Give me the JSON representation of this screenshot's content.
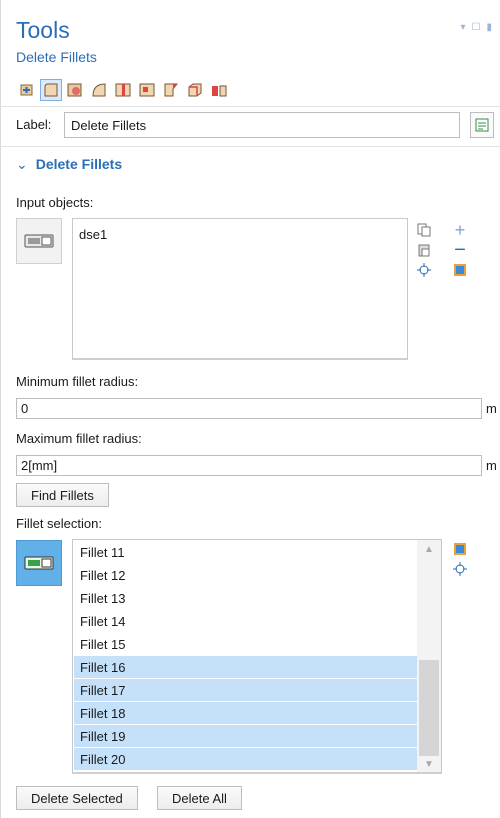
{
  "header": {
    "title": "Tools",
    "subtitle": "Delete Fillets"
  },
  "toolbar": {
    "icons": [
      "build-icon",
      "delete-fillets-icon",
      "cap-faces-icon",
      "delete-faces-icon",
      "split-face-icon",
      "merge-edges-icon",
      "collapse-edges-icon",
      "ignore-vertices-icon",
      "detach-faces-icon"
    ]
  },
  "label_row": {
    "label": "Label:",
    "value": "Delete Fillets"
  },
  "section": {
    "title": "Delete Fillets"
  },
  "input_objects": {
    "label": "Input objects:",
    "items": [
      "dse1"
    ]
  },
  "min_radius": {
    "label": "Minimum fillet radius:",
    "value": "0",
    "unit": "m"
  },
  "max_radius": {
    "label": "Maximum fillet radius:",
    "value": "2[mm]",
    "unit": "m"
  },
  "find_button": "Find Fillets",
  "fillet_selection": {
    "label": "Fillet selection:",
    "items": [
      {
        "name": "Fillet 11",
        "selected": false
      },
      {
        "name": "Fillet 12",
        "selected": false
      },
      {
        "name": "Fillet 13",
        "selected": false
      },
      {
        "name": "Fillet 14",
        "selected": false
      },
      {
        "name": "Fillet 15",
        "selected": false
      },
      {
        "name": "Fillet 16",
        "selected": true
      },
      {
        "name": "Fillet 17",
        "selected": true
      },
      {
        "name": "Fillet 18",
        "selected": true
      },
      {
        "name": "Fillet 19",
        "selected": true
      },
      {
        "name": "Fillet 20",
        "selected": true
      }
    ]
  },
  "buttons": {
    "delete_selected": "Delete Selected",
    "delete_all": "Delete All"
  },
  "colors": {
    "accent": "#2a6fb6",
    "selection": "#c5e1f9",
    "active_button": "#61b0e8"
  }
}
